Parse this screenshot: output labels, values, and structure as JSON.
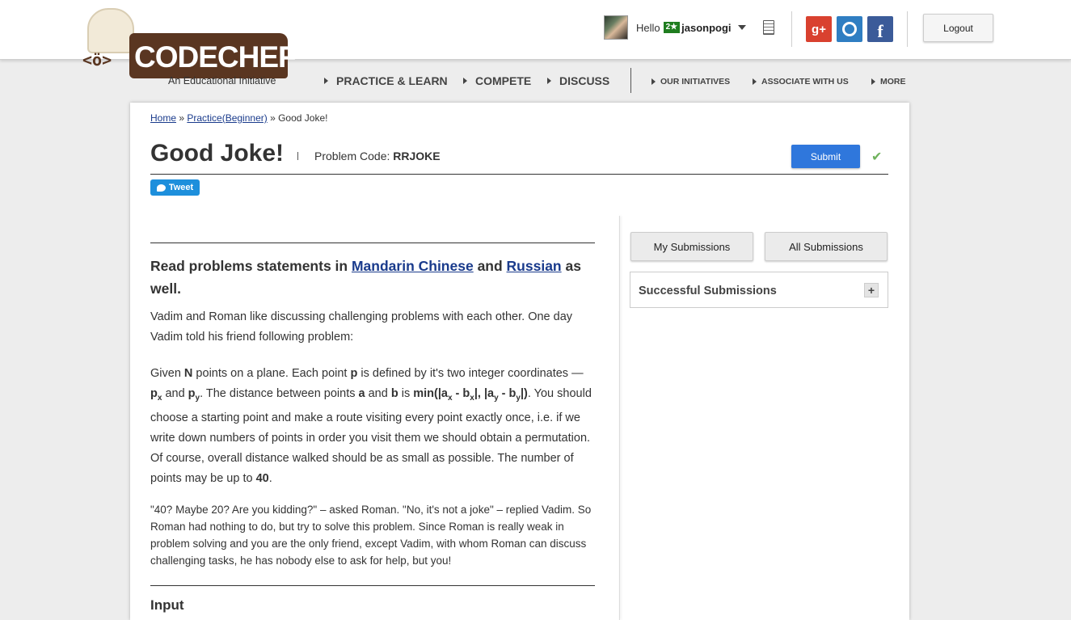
{
  "brand": {
    "logo_text": "CODECHEF",
    "logo_face": "<ö>",
    "tagline": "An Educational Initiative"
  },
  "header": {
    "greeting": "Hello",
    "user_rating_badge": "2★",
    "username": "jasonpogi",
    "social": {
      "gplus": "g+",
      "facebook": "f"
    },
    "logout_label": "Logout"
  },
  "nav": {
    "main": [
      "PRACTICE & LEARN",
      "COMPETE",
      "DISCUSS"
    ],
    "secondary": [
      "OUR INITIATIVES",
      "ASSOCIATE WITH US",
      "MORE"
    ]
  },
  "breadcrumb": {
    "home": "Home",
    "sep1": " » ",
    "practice": "Practice(Beginner)",
    "sep2": " » ",
    "current": "Good Joke!"
  },
  "problem": {
    "title": "Good Joke!",
    "code_label": "Problem Code: ",
    "code": "RRJOKE",
    "submit_label": "Submit",
    "check": "✔",
    "tweet_label": "Tweet"
  },
  "statement": {
    "lead_prefix": "Read problems statements in ",
    "lang1": "Mandarin Chinese",
    "lead_and": " and ",
    "lang2": "Russian",
    "lead_suffix": " as well.",
    "p1": "Vadim and Roman like discussing challenging problems with each other. One day Vadim told his friend following problem:",
    "p2": {
      "t1": "Given ",
      "n": "N",
      "t2": " points on a plane. Each point ",
      "p": "p",
      "t3": " is defined by it's two integer coordinates — ",
      "px": "p",
      "px_sub": "x",
      "t4": " and ",
      "py": "p",
      "py_sub": "y",
      "t5": ". The distance between points ",
      "a": "a",
      "t6": " and ",
      "b": "b",
      "t7": " is ",
      "f1": "min(|a",
      "f1_sub": "x",
      "f2": " - b",
      "f2_sub": "x",
      "f3": "|, |a",
      "f3_sub": "y",
      "f4": " - b",
      "f4_sub": "y",
      "f5": "|)",
      "t8": ". You should choose a starting point and make a route visiting every point exactly once, i.e. if we write down numbers of points in order you visit them we should obtain a permutation. Of course, overall distance walked should be as small as possible. The number of points may be up to ",
      "max": "40",
      "t9": "."
    },
    "p3": "\"40? Maybe 20? Are you kidding?\" – asked Roman. \"No, it's not a joke\" – replied Vadim. So Roman had nothing to do, but try to solve this problem. Since Roman is really weak in problem solving and you are the only friend, except Vadim, with whom Roman can discuss challenging tasks, he has nobody else to ask for help, but you!",
    "input_heading": "Input"
  },
  "sidebar": {
    "my_submissions": "My Submissions",
    "all_submissions": "All Submissions",
    "successful_submissions": "Successful Submissions",
    "expand": "+"
  },
  "colors": {
    "brand_brown": "#5a3621",
    "submit_blue": "#2f77dc",
    "link_blue": "#1a3b8c",
    "success_green": "#6fb25c"
  }
}
